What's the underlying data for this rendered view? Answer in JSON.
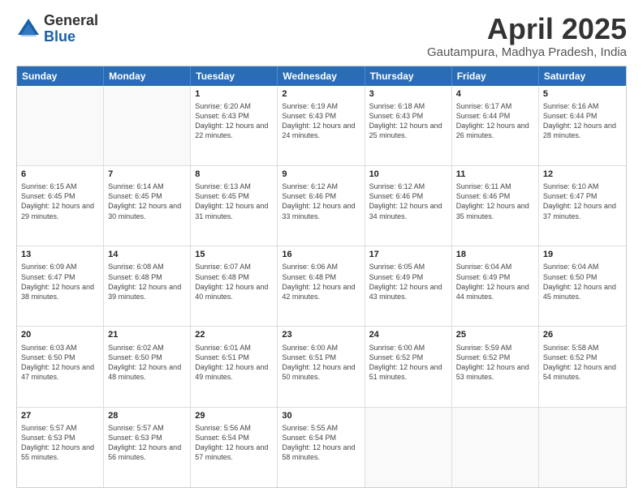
{
  "logo": {
    "general": "General",
    "blue": "Blue"
  },
  "title": "April 2025",
  "location": "Gautampura, Madhya Pradesh, India",
  "headers": [
    "Sunday",
    "Monday",
    "Tuesday",
    "Wednesday",
    "Thursday",
    "Friday",
    "Saturday"
  ],
  "weeks": [
    [
      {
        "day": "",
        "sunrise": "",
        "sunset": "",
        "daylight": ""
      },
      {
        "day": "",
        "sunrise": "",
        "sunset": "",
        "daylight": ""
      },
      {
        "day": "1",
        "sunrise": "Sunrise: 6:20 AM",
        "sunset": "Sunset: 6:43 PM",
        "daylight": "Daylight: 12 hours and 22 minutes."
      },
      {
        "day": "2",
        "sunrise": "Sunrise: 6:19 AM",
        "sunset": "Sunset: 6:43 PM",
        "daylight": "Daylight: 12 hours and 24 minutes."
      },
      {
        "day": "3",
        "sunrise": "Sunrise: 6:18 AM",
        "sunset": "Sunset: 6:43 PM",
        "daylight": "Daylight: 12 hours and 25 minutes."
      },
      {
        "day": "4",
        "sunrise": "Sunrise: 6:17 AM",
        "sunset": "Sunset: 6:44 PM",
        "daylight": "Daylight: 12 hours and 26 minutes."
      },
      {
        "day": "5",
        "sunrise": "Sunrise: 6:16 AM",
        "sunset": "Sunset: 6:44 PM",
        "daylight": "Daylight: 12 hours and 28 minutes."
      }
    ],
    [
      {
        "day": "6",
        "sunrise": "Sunrise: 6:15 AM",
        "sunset": "Sunset: 6:45 PM",
        "daylight": "Daylight: 12 hours and 29 minutes."
      },
      {
        "day": "7",
        "sunrise": "Sunrise: 6:14 AM",
        "sunset": "Sunset: 6:45 PM",
        "daylight": "Daylight: 12 hours and 30 minutes."
      },
      {
        "day": "8",
        "sunrise": "Sunrise: 6:13 AM",
        "sunset": "Sunset: 6:45 PM",
        "daylight": "Daylight: 12 hours and 31 minutes."
      },
      {
        "day": "9",
        "sunrise": "Sunrise: 6:12 AM",
        "sunset": "Sunset: 6:46 PM",
        "daylight": "Daylight: 12 hours and 33 minutes."
      },
      {
        "day": "10",
        "sunrise": "Sunrise: 6:12 AM",
        "sunset": "Sunset: 6:46 PM",
        "daylight": "Daylight: 12 hours and 34 minutes."
      },
      {
        "day": "11",
        "sunrise": "Sunrise: 6:11 AM",
        "sunset": "Sunset: 6:46 PM",
        "daylight": "Daylight: 12 hours and 35 minutes."
      },
      {
        "day": "12",
        "sunrise": "Sunrise: 6:10 AM",
        "sunset": "Sunset: 6:47 PM",
        "daylight": "Daylight: 12 hours and 37 minutes."
      }
    ],
    [
      {
        "day": "13",
        "sunrise": "Sunrise: 6:09 AM",
        "sunset": "Sunset: 6:47 PM",
        "daylight": "Daylight: 12 hours and 38 minutes."
      },
      {
        "day": "14",
        "sunrise": "Sunrise: 6:08 AM",
        "sunset": "Sunset: 6:48 PM",
        "daylight": "Daylight: 12 hours and 39 minutes."
      },
      {
        "day": "15",
        "sunrise": "Sunrise: 6:07 AM",
        "sunset": "Sunset: 6:48 PM",
        "daylight": "Daylight: 12 hours and 40 minutes."
      },
      {
        "day": "16",
        "sunrise": "Sunrise: 6:06 AM",
        "sunset": "Sunset: 6:48 PM",
        "daylight": "Daylight: 12 hours and 42 minutes."
      },
      {
        "day": "17",
        "sunrise": "Sunrise: 6:05 AM",
        "sunset": "Sunset: 6:49 PM",
        "daylight": "Daylight: 12 hours and 43 minutes."
      },
      {
        "day": "18",
        "sunrise": "Sunrise: 6:04 AM",
        "sunset": "Sunset: 6:49 PM",
        "daylight": "Daylight: 12 hours and 44 minutes."
      },
      {
        "day": "19",
        "sunrise": "Sunrise: 6:04 AM",
        "sunset": "Sunset: 6:50 PM",
        "daylight": "Daylight: 12 hours and 45 minutes."
      }
    ],
    [
      {
        "day": "20",
        "sunrise": "Sunrise: 6:03 AM",
        "sunset": "Sunset: 6:50 PM",
        "daylight": "Daylight: 12 hours and 47 minutes."
      },
      {
        "day": "21",
        "sunrise": "Sunrise: 6:02 AM",
        "sunset": "Sunset: 6:50 PM",
        "daylight": "Daylight: 12 hours and 48 minutes."
      },
      {
        "day": "22",
        "sunrise": "Sunrise: 6:01 AM",
        "sunset": "Sunset: 6:51 PM",
        "daylight": "Daylight: 12 hours and 49 minutes."
      },
      {
        "day": "23",
        "sunrise": "Sunrise: 6:00 AM",
        "sunset": "Sunset: 6:51 PM",
        "daylight": "Daylight: 12 hours and 50 minutes."
      },
      {
        "day": "24",
        "sunrise": "Sunrise: 6:00 AM",
        "sunset": "Sunset: 6:52 PM",
        "daylight": "Daylight: 12 hours and 51 minutes."
      },
      {
        "day": "25",
        "sunrise": "Sunrise: 5:59 AM",
        "sunset": "Sunset: 6:52 PM",
        "daylight": "Daylight: 12 hours and 53 minutes."
      },
      {
        "day": "26",
        "sunrise": "Sunrise: 5:58 AM",
        "sunset": "Sunset: 6:52 PM",
        "daylight": "Daylight: 12 hours and 54 minutes."
      }
    ],
    [
      {
        "day": "27",
        "sunrise": "Sunrise: 5:57 AM",
        "sunset": "Sunset: 6:53 PM",
        "daylight": "Daylight: 12 hours and 55 minutes."
      },
      {
        "day": "28",
        "sunrise": "Sunrise: 5:57 AM",
        "sunset": "Sunset: 6:53 PM",
        "daylight": "Daylight: 12 hours and 56 minutes."
      },
      {
        "day": "29",
        "sunrise": "Sunrise: 5:56 AM",
        "sunset": "Sunset: 6:54 PM",
        "daylight": "Daylight: 12 hours and 57 minutes."
      },
      {
        "day": "30",
        "sunrise": "Sunrise: 5:55 AM",
        "sunset": "Sunset: 6:54 PM",
        "daylight": "Daylight: 12 hours and 58 minutes."
      },
      {
        "day": "",
        "sunrise": "",
        "sunset": "",
        "daylight": ""
      },
      {
        "day": "",
        "sunrise": "",
        "sunset": "",
        "daylight": ""
      },
      {
        "day": "",
        "sunrise": "",
        "sunset": "",
        "daylight": ""
      }
    ]
  ]
}
